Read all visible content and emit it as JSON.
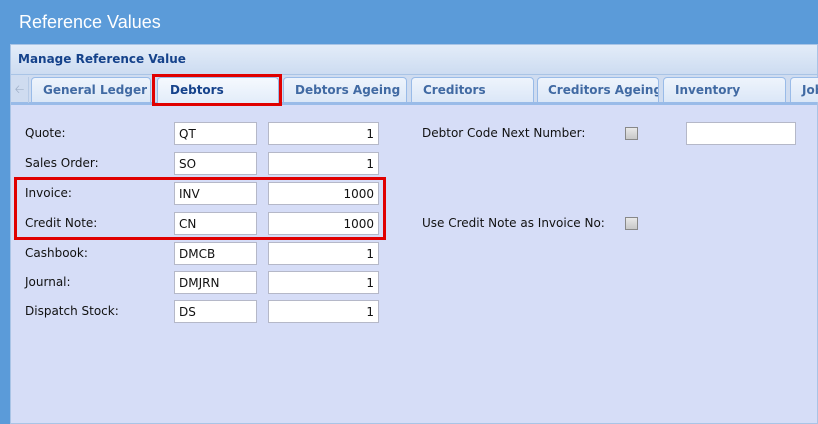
{
  "window_title": "Reference Values",
  "panel_title": "Manage Reference Value",
  "tabs": [
    "General Ledger",
    "Debtors",
    "Debtors Ageing",
    "Creditors",
    "Creditors Ageing",
    "Inventory",
    "Job"
  ],
  "active_tab": "Debtors",
  "rows": [
    {
      "label": "Quote:",
      "code": "QT",
      "number": "1"
    },
    {
      "label": "Sales Order:",
      "code": "SO",
      "number": "1"
    },
    {
      "label": "Invoice:",
      "code": "INV",
      "number": "1000"
    },
    {
      "label": "Credit Note:",
      "code": "CN",
      "number": "1000"
    },
    {
      "label": "Cashbook:",
      "code": "DMCB",
      "number": "1"
    },
    {
      "label": "Journal:",
      "code": "DMJRN",
      "number": "1"
    },
    {
      "label": "Dispatch Stock:",
      "code": "DS",
      "number": "1"
    }
  ],
  "debtor_code_next_number": {
    "label": "Debtor Code Next Number:",
    "checked": false,
    "value": ""
  },
  "use_credit_note_as_invoice_no": {
    "label": "Use Credit Note as Invoice No:",
    "checked": false
  },
  "highlight_color": "#e00000"
}
